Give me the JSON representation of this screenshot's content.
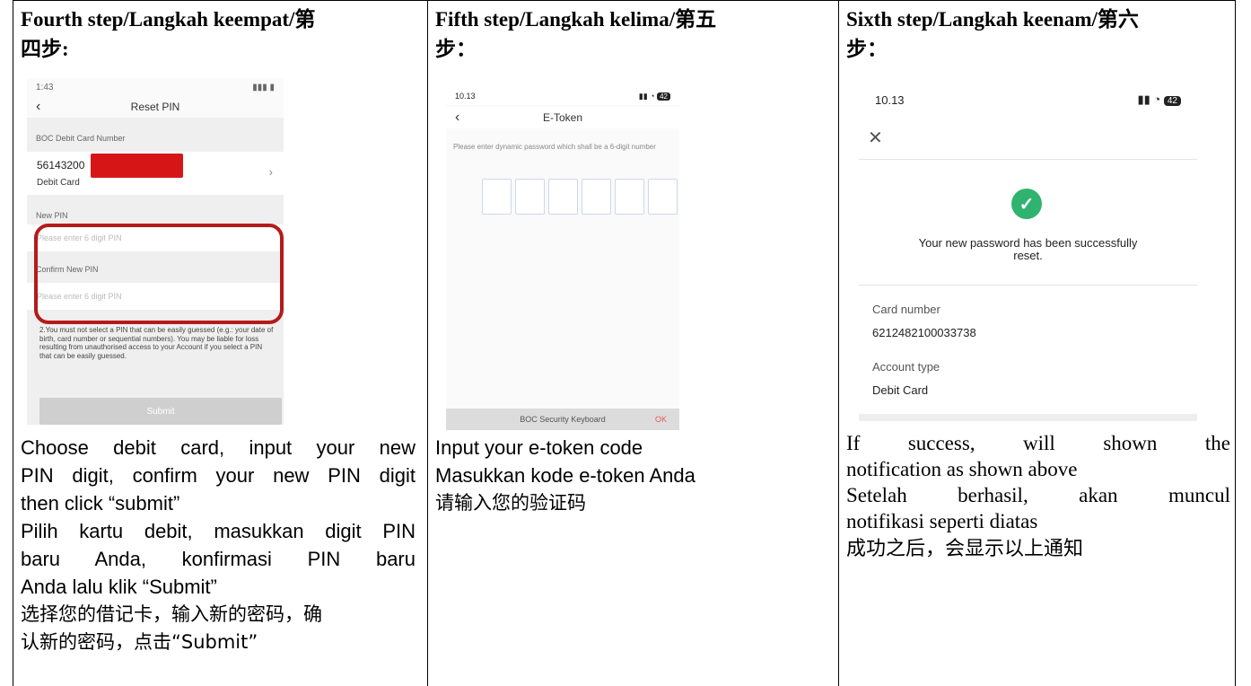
{
  "columns": [
    {
      "heading_line1": "Fourth step/Langkah keempat/第",
      "heading_line2": "四步:",
      "phone": {
        "status_time": "1:43",
        "title": "Reset PIN",
        "card_section": "BOC Debit Card Number",
        "card_number": "56143200",
        "card_type": "Debit Card",
        "new_pin_label": "New PIN",
        "new_pin_placeholder": "Please enter 6 digit PIN",
        "confirm_label": "Confirm New PIN",
        "confirm_placeholder": "Please enter 6 digit PIN",
        "note": "2.You must not select a PIN that can be easily guessed (e.g.: your date of birth, card number or sequential numbers). You may be liable for loss resulting from unauthorised access to your Account if you select a PIN that can be easily guessed.",
        "submit": "Submit"
      },
      "caption": [
        "Choose debit card, input your new",
        "PIN digit, confirm your new PIN digit",
        "then click “submit”",
        "Pilih kartu debit, masukkan digit PIN",
        "baru Anda, konfirmasi PIN baru",
        "Anda lalu klik “Submit”",
        "选择您的借记卡，输入新的密码，确",
        "认新的密码，点击“Submit”"
      ]
    },
    {
      "heading_line1": "Fifth step/Langkah kelima/第五",
      "heading_line2": "步：",
      "phone": {
        "status_time": "10.13",
        "battery": "42",
        "title": "E-Token",
        "hint": "Please enter dynamic password which shall be a 6-digit number",
        "keyboard": "BOC Security Keyboard",
        "ok": "OK"
      },
      "caption": [
        "Input your e-token code",
        "Masukkan kode e-token Anda",
        "请输入您的验证码"
      ]
    },
    {
      "heading_line1": "Sixth step/Langkah keenam/第六",
      "heading_line2": "步：",
      "phone": {
        "status_time": "10.13",
        "battery": "42",
        "message_line1": "Your new password has been successfully",
        "message_line2": "reset.",
        "card_label": "Card number",
        "card_value": "6212482100033738",
        "account_label": "Account type",
        "account_value": "Debit Card"
      },
      "caption": [
        "If success, will shown the",
        "notification as shown above",
        "Setelah berhasil, akan muncul",
        "notifikasi seperti diatas",
        "成功之后，会显示以上通知"
      ]
    }
  ],
  "colors": {
    "highlight_ring": "#b31b1b",
    "redaction": "#d61616",
    "success_check": "#2fb36f"
  }
}
